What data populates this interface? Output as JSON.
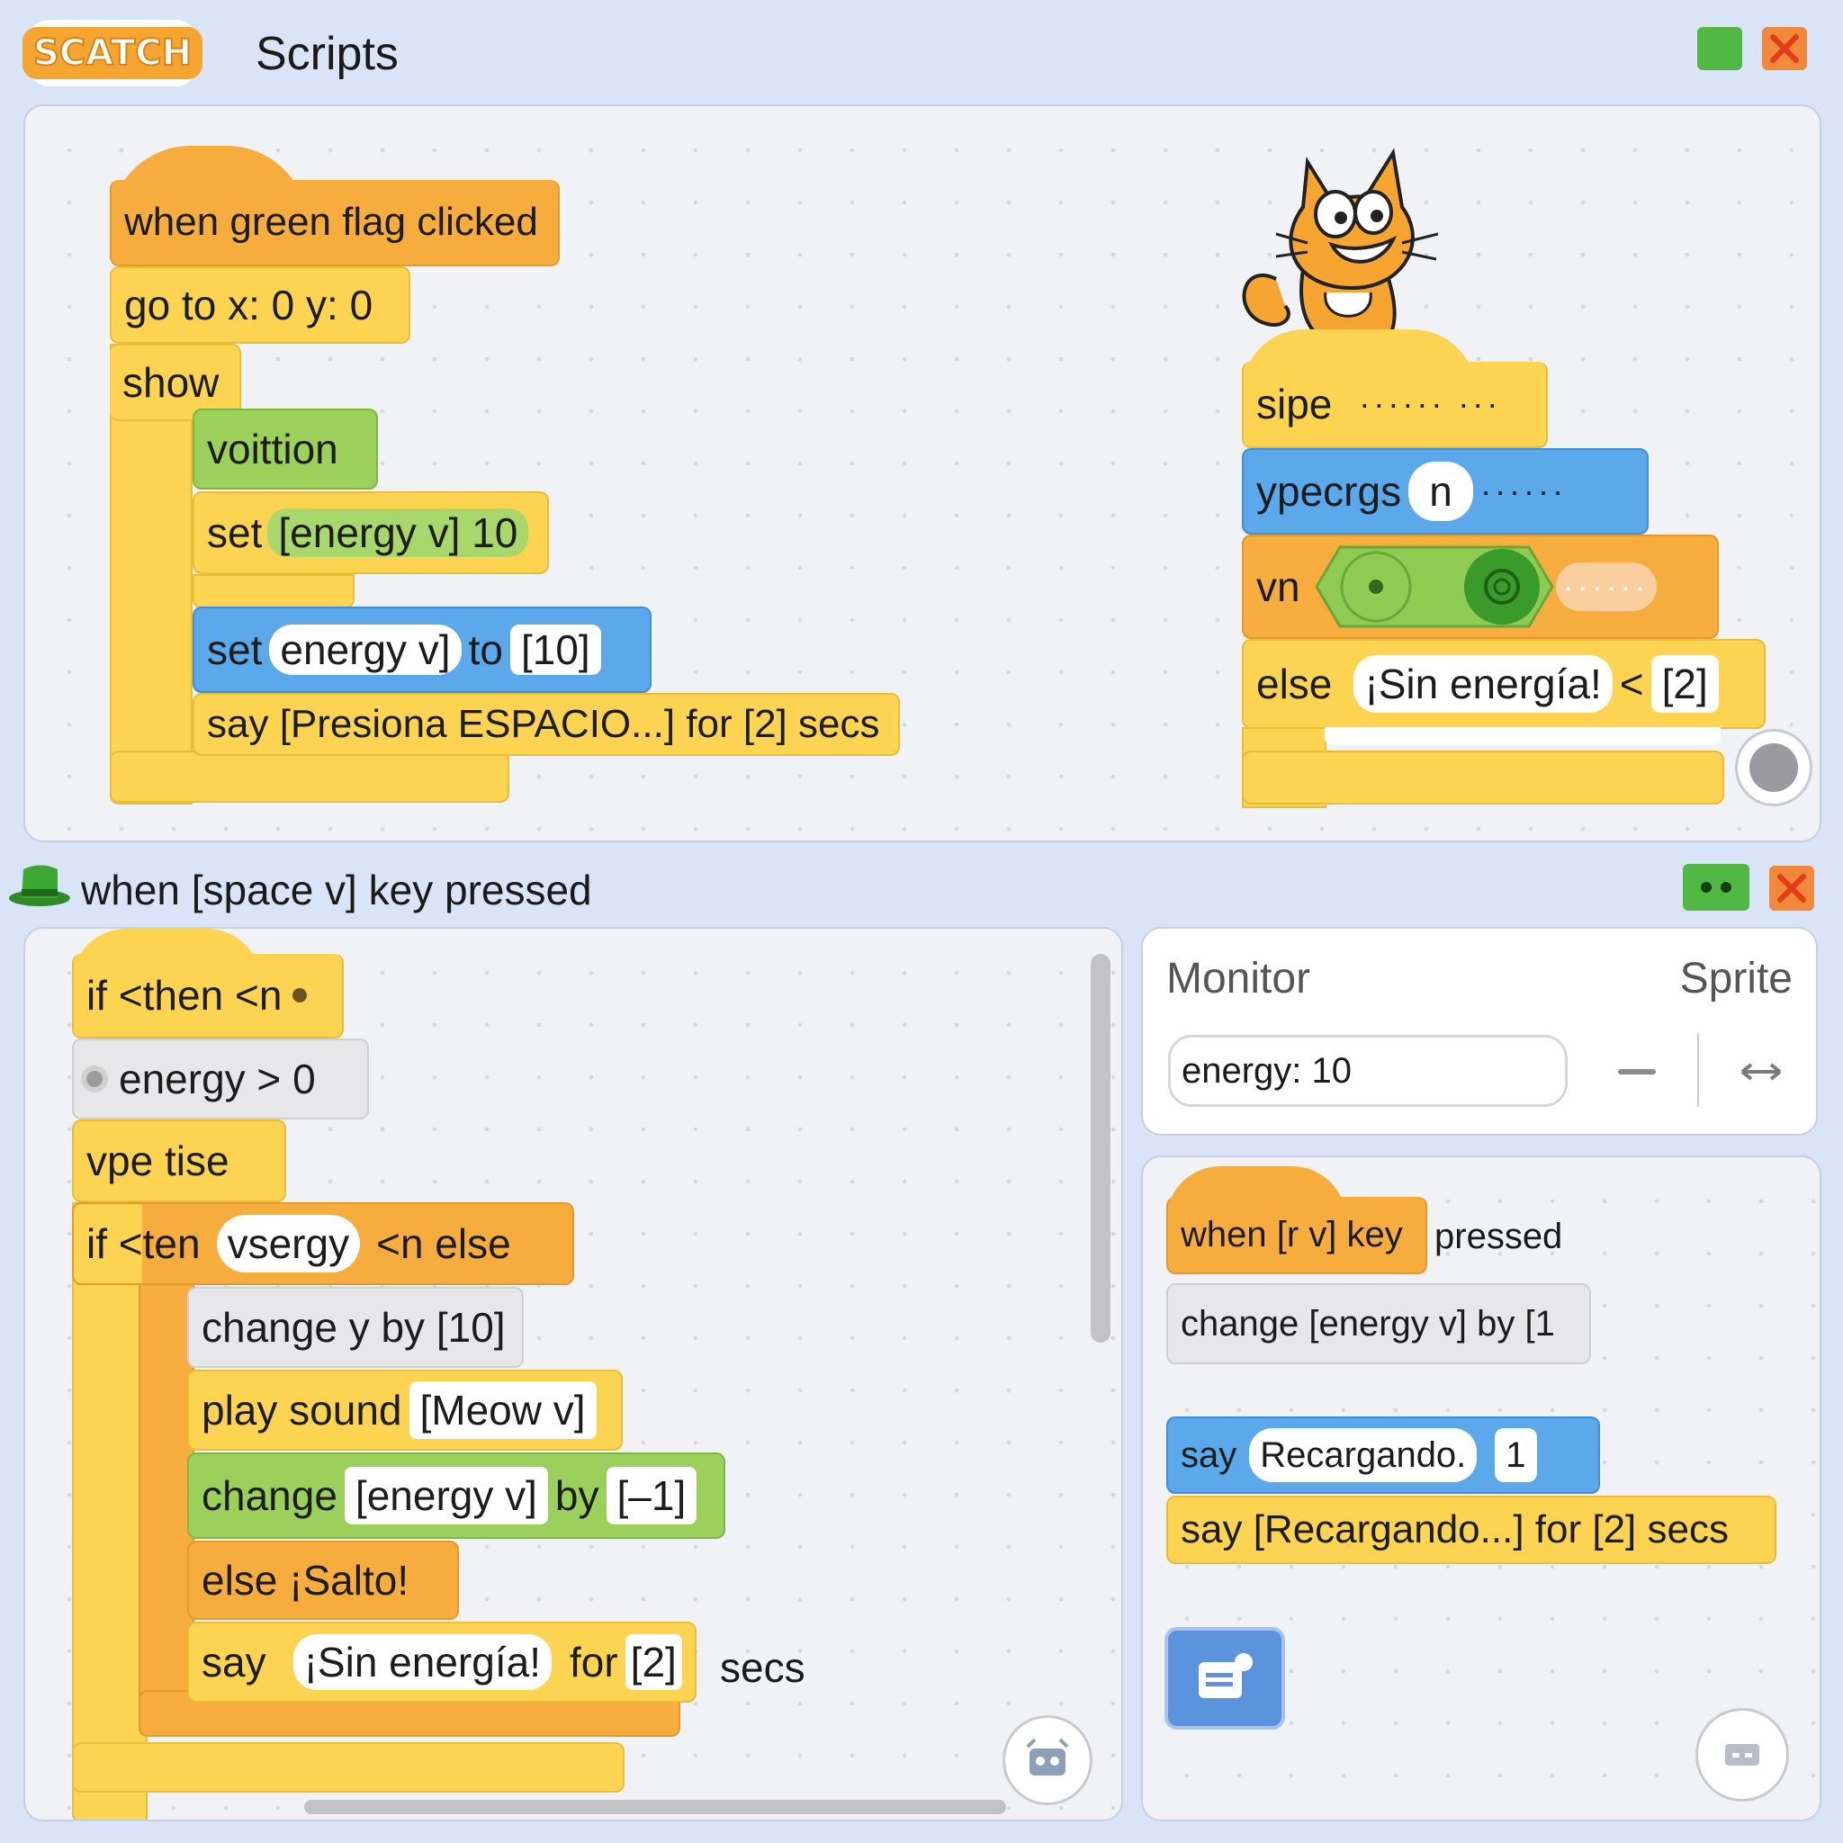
{
  "app": {
    "logo_text": "SCATCH",
    "title": "Scripts"
  },
  "colors": {
    "event": "#f7ad3d",
    "control": "#fcd452",
    "looks": "#9bd05a",
    "motion": "#5ba8ea",
    "sensing": "#e7e7e9",
    "close": "#f08a3a",
    "ok": "#52b844"
  },
  "top_panel": {
    "script1": {
      "hat": "when green flag clicked",
      "goto": "go to x: 0 y: 0",
      "show": "show",
      "voittion": "voittion",
      "set1_prefix": "set",
      "set1_var": "[energy v] 10",
      "set2_prefix": "set",
      "set2_var": "energy v]",
      "set2_to": "to",
      "set2_val": "[10]",
      "say": "say [Presiona ESPACIO...] for [2] secs"
    },
    "script2": {
      "sipe": "sipe",
      "sipe_dots": "······ ···",
      "ypecrgs": "ypecrgs",
      "ypecrgs_pill": "n",
      "ypecrgs_dots": "······",
      "vn": "vn",
      "vn_dots": "······",
      "else": "else",
      "else_text": "¡Sin energía!",
      "else_op": "<",
      "else_val": "[2]"
    }
  },
  "bottom_header": {
    "title": "when [space v] key pressed"
  },
  "left_panel": {
    "if1": "if <then <n",
    "cond": "energy > 0",
    "vpe": "vpe  tise",
    "if2_prefix": "if <ten",
    "if2_pill": "vsergy",
    "if2_suffix": "<n else",
    "change_y": "change y by [10]",
    "play_prefix": "play sound",
    "play_val": "[Meow v]",
    "change_prefix": "change",
    "change_var": "[energy v]",
    "change_by": "by",
    "change_val": "[–1]",
    "else_salto": "else  ¡Salto!",
    "say_prefix": "say",
    "say_pill": "¡Sin energía!",
    "say_for": "for",
    "say_val": "[2]",
    "say_secs": "secs"
  },
  "monitor": {
    "tab_monitor": "Monitor",
    "tab_sprite": "Sprite",
    "value": "energy: 10"
  },
  "right_script": {
    "hat_a": "when [r v] key",
    "hat_b": "pressed",
    "change": "change [energy v] by [1",
    "say_prefix": "say",
    "say_pill": "Recargando.",
    "say_val": "1",
    "say2": "say [Recargando...] for [2] secs"
  },
  "icons": [
    "green-square-icon",
    "close-x-icon",
    "green-hat-icon",
    "eyes-icon",
    "cat-sprite-icon",
    "add-comment-icon",
    "extension-icon",
    "record-button-icon",
    "minus-icon",
    "resize-arrows-icon"
  ]
}
